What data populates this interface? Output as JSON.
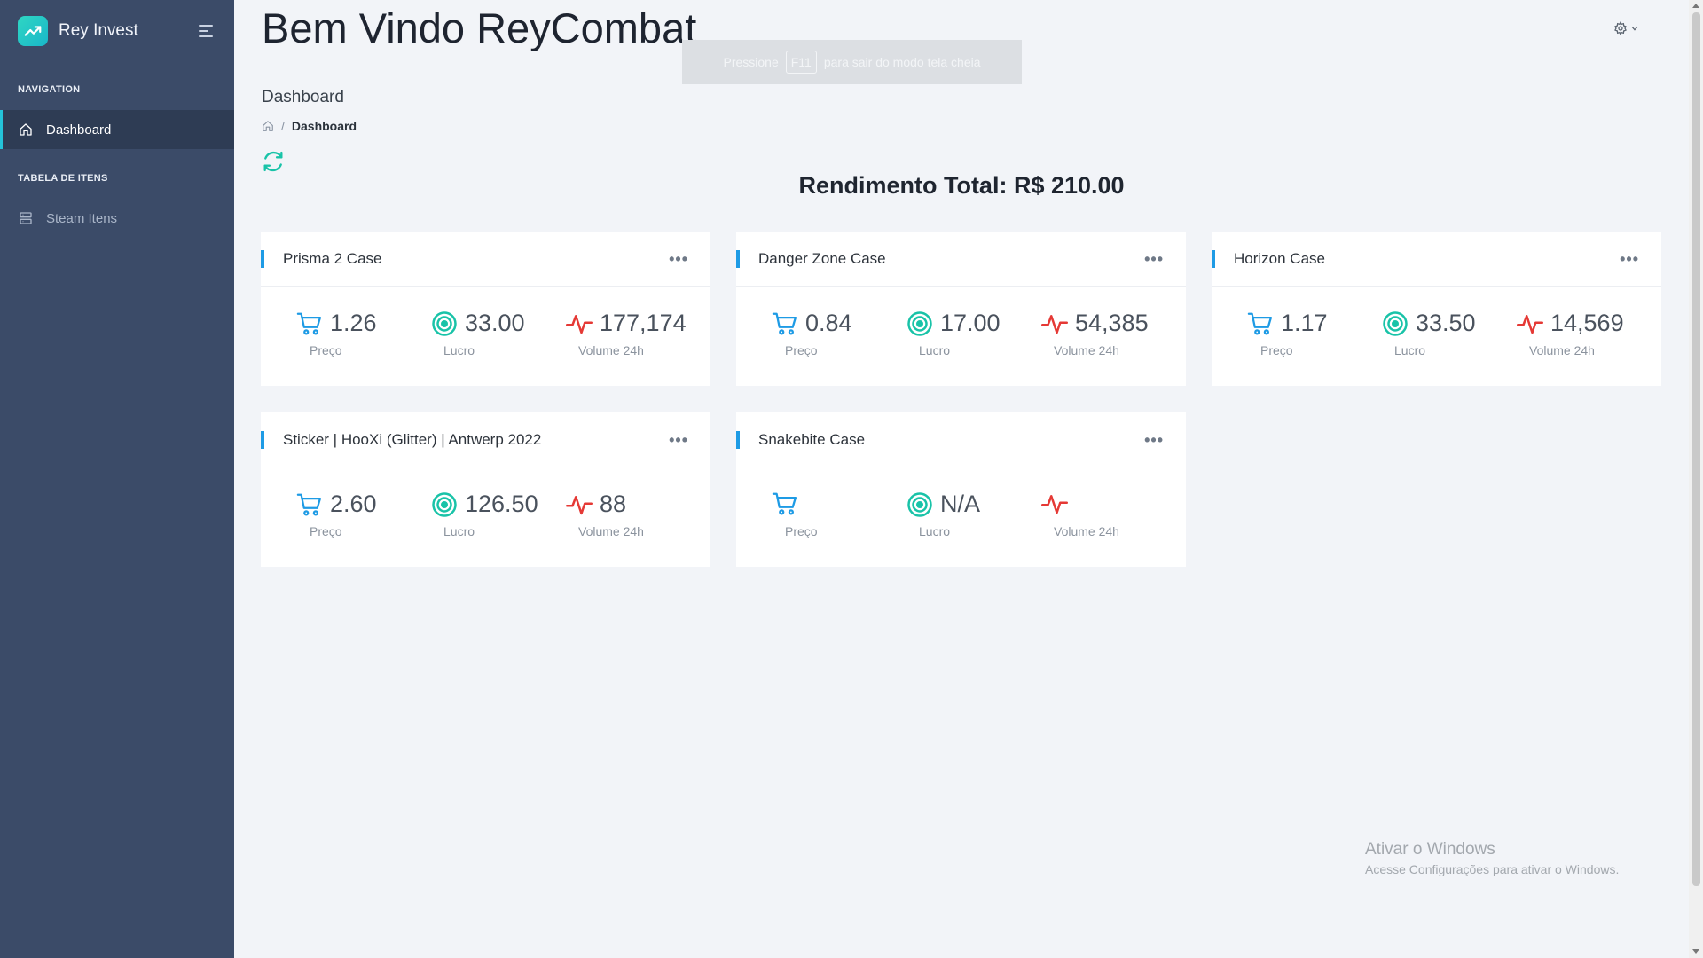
{
  "app": {
    "name": "Rey Invest"
  },
  "sidebar": {
    "sections": [
      {
        "title": "NAVIGATION",
        "items": [
          {
            "label": "Dashboard",
            "icon": "home-icon",
            "active": true
          }
        ]
      },
      {
        "title": "TABELA DE ITENS",
        "items": [
          {
            "label": "Steam Itens",
            "icon": "server-icon",
            "active": false
          }
        ]
      }
    ]
  },
  "header": {
    "welcome": "Bem Vindo ReyCombat"
  },
  "fullscreen_toast": {
    "before": "Pressione",
    "key": "F11",
    "after": "para sair do modo tela cheia"
  },
  "page": {
    "heading": "Dashboard",
    "breadcrumb_current": "Dashboard",
    "breadcrumb_sep": "/"
  },
  "total": {
    "text": "Rendimento Total: R$ 210.00"
  },
  "labels": {
    "price": "Preço",
    "profit": "Lucro",
    "volume": "Volume 24h"
  },
  "cards": [
    {
      "title": "Prisma 2 Case",
      "menu": "•••",
      "price": "1.26",
      "profit": "33.00",
      "volume": "177,174"
    },
    {
      "title": "Danger Zone Case",
      "menu": "•••",
      "price": "0.84",
      "profit": "17.00",
      "volume": "54,385"
    },
    {
      "title": "Horizon Case",
      "menu": "•••",
      "price": "1.17",
      "profit": "33.50",
      "volume": "14,569"
    },
    {
      "title": "Sticker | HooXi (Glitter) | Antwerp 2022",
      "menu": "•••",
      "price": "2.60",
      "profit": "126.50",
      "volume": "88"
    },
    {
      "title": "Snakebite Case",
      "menu": "•••",
      "price": "",
      "profit": "N/A",
      "volume": ""
    }
  ],
  "watermark": {
    "line1": "Ativar o Windows",
    "line2": "Acesse Configurações para ativar o Windows."
  },
  "colors": {
    "sidebar": "#3b4b68",
    "accent": "#1e9be5",
    "teal": "#19c3a8",
    "red": "#e53935",
    "background": "#f2f4f8"
  }
}
